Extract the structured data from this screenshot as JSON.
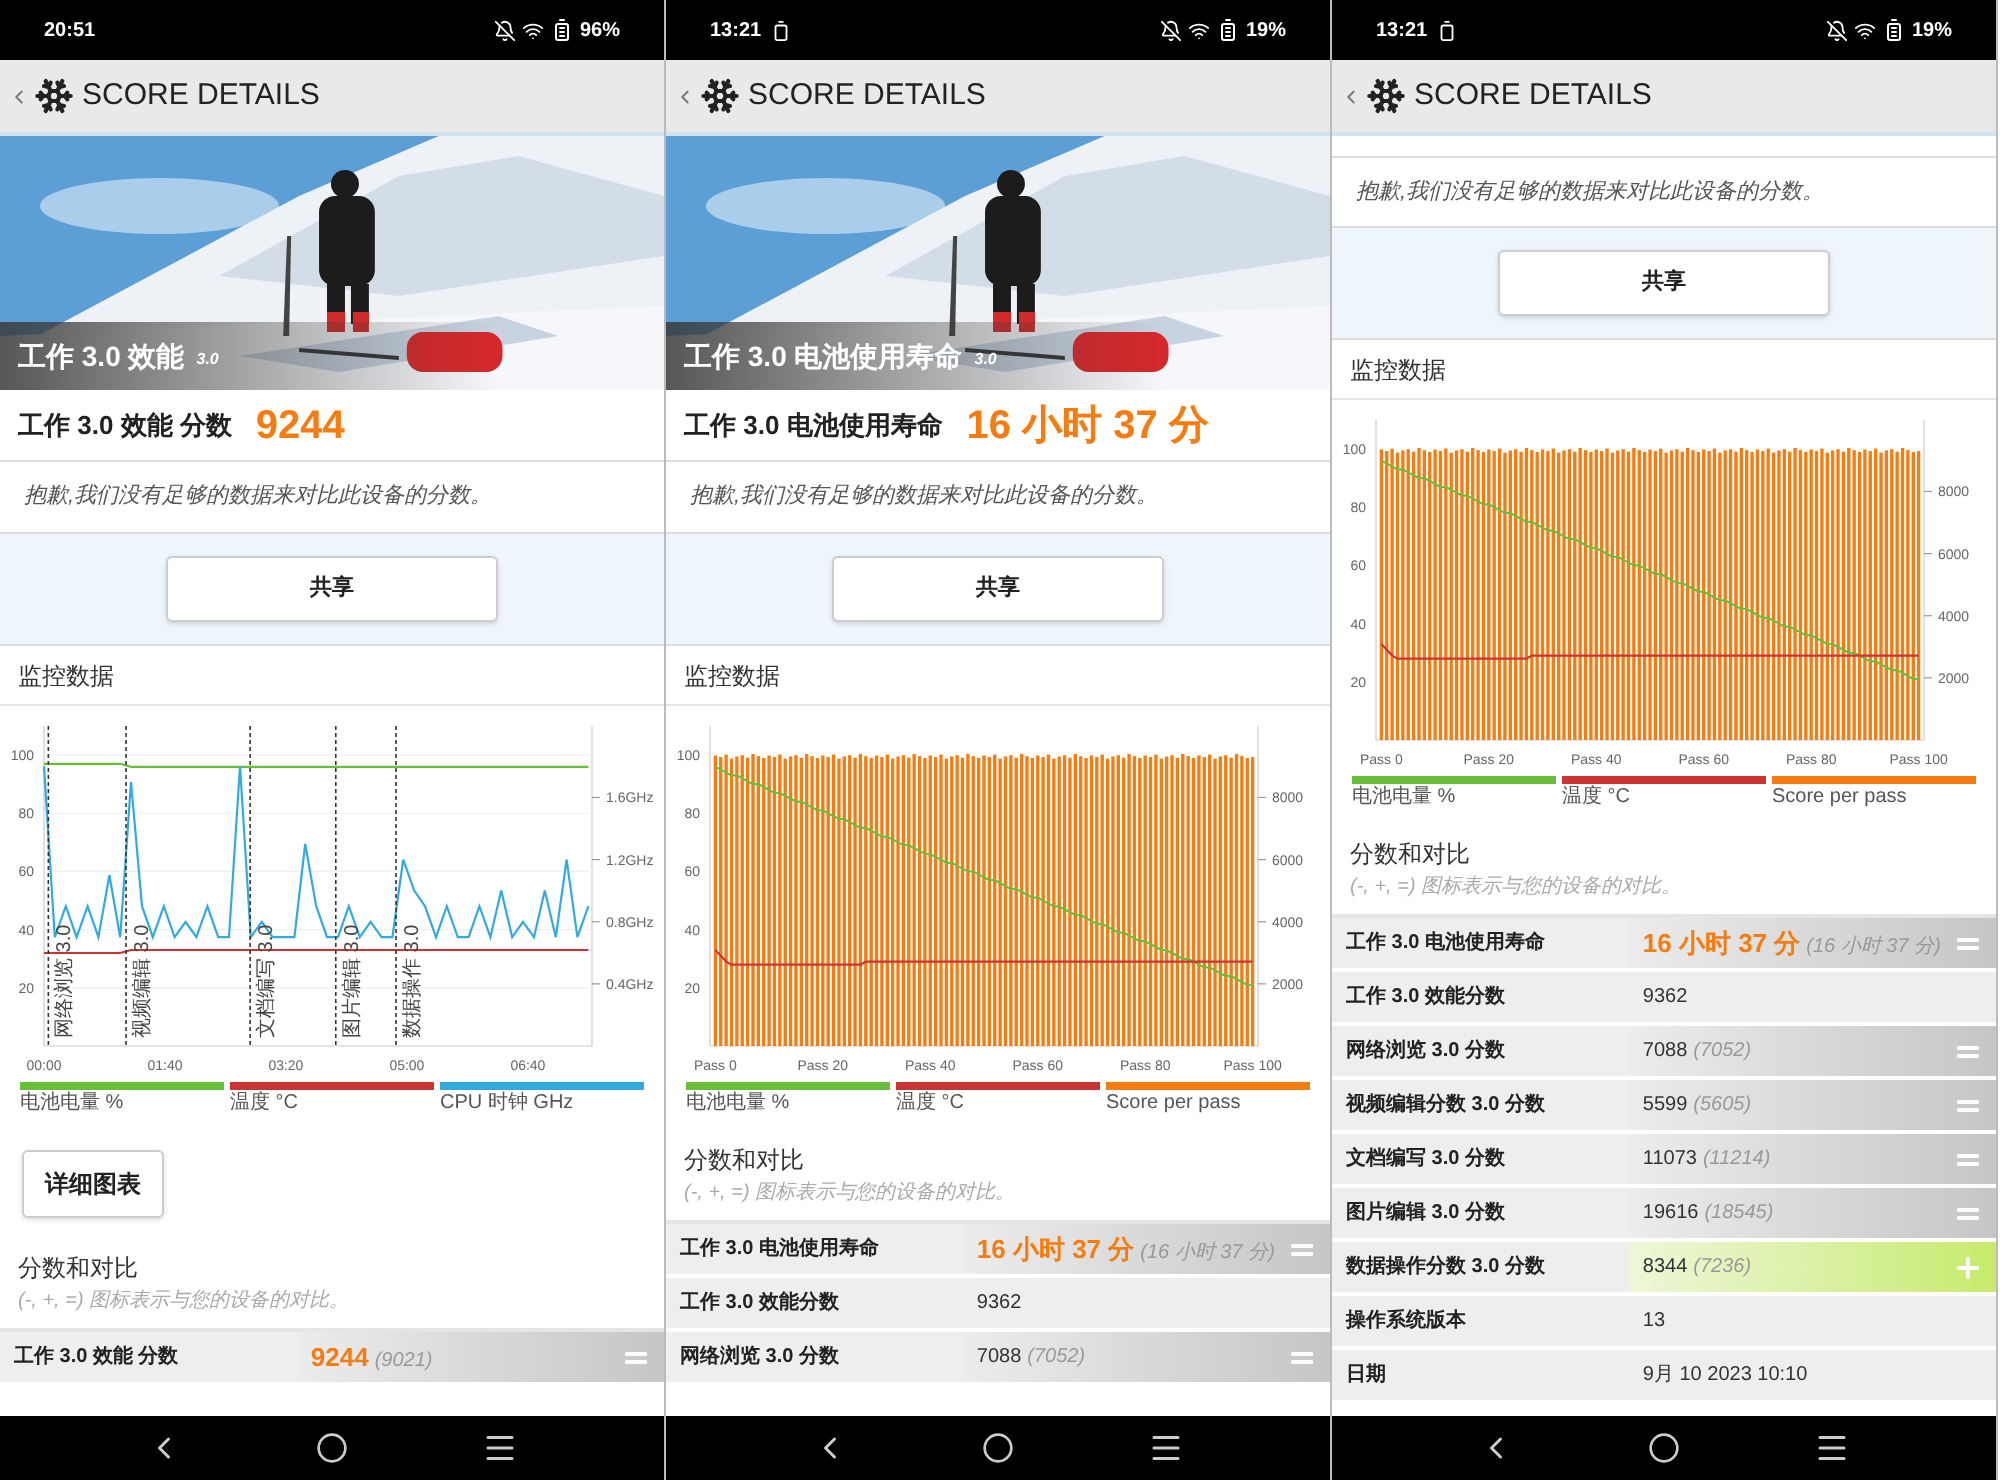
{
  "screens": [
    {
      "status": {
        "time": "20:51",
        "battery": "96%",
        "notification_icon": false
      },
      "header": {
        "title": "SCORE DETAILS"
      },
      "sections": [
        {
          "kind": "hero",
          "title": "工作 3.0 效能",
          "version": "3.0"
        },
        {
          "kind": "score",
          "label": "工作 3.0 效能 分数",
          "value": "9244"
        },
        {
          "kind": "notice",
          "text": "抱歉,我们没有足够的数据来对比此设备的分数。"
        },
        {
          "kind": "share",
          "label": "共享"
        },
        {
          "kind": "monitor",
          "heading": "监控数据",
          "chart_data": {
            "type": "line",
            "x": [
              0,
              0.15,
              0.3,
              0.45,
              0.6,
              0.75,
              0.9,
              1.05,
              1.2,
              1.35,
              1.5,
              1.65,
              1.8,
              1.95,
              2.1,
              2.25,
              2.4,
              2.55,
              2.7,
              2.85,
              3,
              3.15,
              3.3,
              3.45,
              3.6,
              3.75,
              3.9,
              4.05,
              4.2,
              4.35,
              4.5,
              4.65,
              4.8,
              4.95,
              5.1,
              5.25,
              5.4,
              5.55,
              5.7,
              5.85,
              6,
              6.15,
              6.3,
              6.45,
              6.6,
              6.75,
              6.9,
              7.05,
              7.2,
              7.35,
              7.5
            ],
            "xlim": [
              0,
              7.55
            ],
            "ylim": [
              0,
              110
            ],
            "y2lim": [
              0,
              2.06
            ],
            "xticks": [
              {
                "value": 0,
                "label": "00:00"
              },
              {
                "value": 1.667,
                "label": "01:40"
              },
              {
                "value": 3.333,
                "label": "03:20"
              },
              {
                "value": 5,
                "label": "05:00"
              },
              {
                "value": 6.667,
                "label": "06:40"
              }
            ],
            "yticks": [
              20,
              40,
              60,
              80,
              100
            ],
            "y2ticks": [
              {
                "value": 0.4,
                "label": "0.4GHz"
              },
              {
                "value": 0.8,
                "label": "0.8GHz"
              },
              {
                "value": 1.2,
                "label": "1.2GHz"
              },
              {
                "value": 1.6,
                "label": "1.6GHz"
              }
            ],
            "series": [
              {
                "name": "电池电量 %",
                "color": "#6abf3a",
                "values": [
                  97,
                  97,
                  97,
                  97,
                  97,
                  97,
                  97,
                  97,
                  96,
                  96,
                  96,
                  96,
                  96,
                  96,
                  96,
                  96,
                  96,
                  96,
                  96,
                  96,
                  96,
                  96,
                  96,
                  96,
                  96,
                  96,
                  96,
                  96,
                  96,
                  96,
                  96,
                  96,
                  96,
                  96,
                  96,
                  96,
                  96,
                  96,
                  96,
                  96,
                  96,
                  96,
                  96,
                  96,
                  96,
                  96,
                  96,
                  96,
                  96,
                  96,
                  96
                ]
              },
              {
                "name": "温度 °C",
                "color": "#cc3333",
                "values": [
                  32,
                  32,
                  32,
                  32,
                  32,
                  32,
                  32,
                  32,
                  33,
                  33,
                  33,
                  33,
                  33,
                  33,
                  33,
                  33,
                  33,
                  33,
                  33,
                  33,
                  33,
                  33,
                  33,
                  33,
                  33,
                  33,
                  33,
                  33,
                  33,
                  33,
                  33,
                  33,
                  33,
                  33,
                  33,
                  33,
                  33,
                  33,
                  33,
                  33,
                  33,
                  33,
                  33,
                  33,
                  33,
                  33,
                  33,
                  33,
                  33,
                  33,
                  33
                ]
              },
              {
                "name": "CPU 时钟 GHz",
                "color": "#33aadd",
                "axis": "y2",
                "values": [
                  1.8,
                  0.7,
                  0.9,
                  0.7,
                  0.9,
                  0.7,
                  1.1,
                  0.7,
                  1.7,
                  0.9,
                  0.7,
                  0.9,
                  0.7,
                  0.8,
                  0.7,
                  0.9,
                  0.7,
                  0.7,
                  1.8,
                  0.7,
                  0.8,
                  0.7,
                  0.7,
                  0.7,
                  1.3,
                  0.9,
                  0.7,
                  0.7,
                  0.9,
                  0.7,
                  0.8,
                  0.7,
                  0.7,
                  1.2,
                  1.0,
                  0.9,
                  0.7,
                  0.9,
                  0.7,
                  0.7,
                  0.9,
                  0.7,
                  1.0,
                  0.7,
                  0.8,
                  0.7,
                  1.0,
                  0.7,
                  1.2,
                  0.7,
                  0.9
                ]
              }
            ],
            "grid": true,
            "ref_lines": [
              {
                "axis": "x",
                "value": 0.06,
                "label": "网络浏览 3.0"
              },
              {
                "axis": "x",
                "value": 1.13,
                "label": "视频编辑 3.0"
              },
              {
                "axis": "x",
                "value": 2.84,
                "label": "文档编写 3.0"
              },
              {
                "axis": "x",
                "value": 4.02,
                "label": "图片编辑 3.0"
              },
              {
                "axis": "x",
                "value": 4.85,
                "label": "数据操作 3.0"
              }
            ]
          }
        },
        {
          "kind": "details",
          "label": "详细图表"
        },
        {
          "kind": "comparison",
          "heading": "分数和对比",
          "hint": "(-, +, =) 图标表示与您的设备的对比。",
          "rows": [
            {
              "label": "工作 3.0 效能 分数",
              "value": "9244",
              "reference": "(9021)",
              "kind": "equal",
              "primary": true
            }
          ]
        }
      ]
    },
    {
      "status": {
        "time": "13:21",
        "battery": "19%",
        "notification_icon": true
      },
      "header": {
        "title": "SCORE DETAILS"
      },
      "sections": [
        {
          "kind": "hero",
          "title": "工作 3.0 电池使用寿命",
          "version": "3.0"
        },
        {
          "kind": "score",
          "label": "工作 3.0 电池使用寿命",
          "value": "16 小时 37 分"
        },
        {
          "kind": "notice",
          "text": "抱歉,我们没有足够的数据来对比此设备的分数。"
        },
        {
          "kind": "share",
          "label": "共享"
        },
        {
          "kind": "monitor",
          "heading": "监控数据",
          "chart_data": {
            "type": "bar",
            "categories": [
              "Pass 0",
              null,
              null,
              null,
              null,
              null,
              null,
              null,
              null,
              null,
              null,
              null,
              null,
              null,
              null,
              null,
              null,
              null,
              null,
              null,
              "Pass 20",
              null,
              null,
              null,
              null,
              null,
              null,
              null,
              null,
              null,
              null,
              null,
              null,
              null,
              null,
              null,
              null,
              null,
              null,
              null,
              "Pass 40",
              null,
              null,
              null,
              null,
              null,
              null,
              null,
              null,
              null,
              null,
              null,
              null,
              null,
              null,
              null,
              null,
              null,
              null,
              null,
              "Pass 60",
              null,
              null,
              null,
              null,
              null,
              null,
              null,
              null,
              null,
              null,
              null,
              null,
              null,
              null,
              null,
              null,
              null,
              null,
              null,
              "Pass 80",
              null,
              null,
              null,
              null,
              null,
              null,
              null,
              null,
              null,
              null,
              null,
              null,
              null,
              null,
              null,
              null,
              null,
              null,
              null,
              "Pass 100"
            ],
            "ylim": [
              0,
              110
            ],
            "y2lim": [
              0,
              10300
            ],
            "yticks": [
              20,
              40,
              60,
              80,
              100
            ],
            "y2ticks": [
              2000,
              4000,
              6000,
              8000
            ],
            "series": [
              {
                "name": "电池电量 %",
                "color": "#6abf3a",
                "type": "line",
                "values": [
                  96,
                  95,
                  94,
                  93,
                  93,
                  92,
                  91,
                  90,
                  90,
                  89,
                  88,
                  87,
                  87,
                  86,
                  85,
                  84,
                  84,
                  83,
                  82,
                  81,
                  81,
                  80,
                  79,
                  78,
                  78,
                  77,
                  76,
                  75,
                  75,
                  74,
                  73,
                  72,
                  72,
                  71,
                  70,
                  69,
                  69,
                  68,
                  67,
                  66,
                  66,
                  65,
                  64,
                  63,
                  63,
                  62,
                  61,
                  60,
                  60,
                  59,
                  58,
                  57,
                  57,
                  56,
                  55,
                  54,
                  54,
                  53,
                  52,
                  51,
                  51,
                  50,
                  49,
                  48,
                  48,
                  47,
                  46,
                  45,
                  45,
                  44,
                  43,
                  42,
                  42,
                  41,
                  40,
                  39,
                  39,
                  38,
                  37,
                  36,
                  36,
                  35,
                  34,
                  33,
                  33,
                  32,
                  31,
                  30,
                  30,
                  29,
                  28,
                  27,
                  27,
                  26,
                  25,
                  24,
                  24,
                  23,
                  22,
                  21,
                  21
                ]
              },
              {
                "name": "温度 °C",
                "color": "#cc3333",
                "type": "line",
                "values": [
                  33,
                  31,
                  29,
                  28,
                  28,
                  28,
                  28,
                  28,
                  28,
                  28,
                  28,
                  28,
                  28,
                  28,
                  28,
                  28,
                  28,
                  28,
                  28,
                  28,
                  28,
                  28,
                  28,
                  28,
                  28,
                  28,
                  28,
                  28,
                  29,
                  29,
                  29,
                  29,
                  29,
                  29,
                  29,
                  29,
                  29,
                  29,
                  29,
                  29,
                  29,
                  29,
                  29,
                  29,
                  29,
                  29,
                  29,
                  29,
                  29,
                  29,
                  29,
                  29,
                  29,
                  29,
                  29,
                  29,
                  29,
                  29,
                  29,
                  29,
                  29,
                  29,
                  29,
                  29,
                  29,
                  29,
                  29,
                  29,
                  29,
                  29,
                  29,
                  29,
                  29,
                  29,
                  29,
                  29,
                  29,
                  29,
                  29,
                  29,
                  29,
                  29,
                  29,
                  29,
                  29,
                  29,
                  29,
                  29,
                  29,
                  29,
                  29,
                  29,
                  29,
                  29,
                  29,
                  29,
                  29,
                  29,
                  29,
                  29,
                  29
                ]
              },
              {
                "name": "Score per pass",
                "color": "#f57c10",
                "axis": "y2",
                "values": [
                  9350,
                  9300,
                  9380,
                  9250,
                  9320,
                  9360,
                  9280,
                  9400,
                  9330,
                  9270,
                  9350,
                  9300,
                  9380,
                  9250,
                  9320,
                  9360,
                  9280,
                  9400,
                  9330,
                  9270,
                  9350,
                  9300,
                  9380,
                  9250,
                  9320,
                  9360,
                  9280,
                  9400,
                  9330,
                  9270,
                  9350,
                  9300,
                  9380,
                  9250,
                  9320,
                  9360,
                  9280,
                  9400,
                  9330,
                  9270,
                  9350,
                  9300,
                  9380,
                  9250,
                  9320,
                  9360,
                  9280,
                  9400,
                  9330,
                  9270,
                  9350,
                  9300,
                  9380,
                  9250,
                  9320,
                  9360,
                  9280,
                  9400,
                  9330,
                  9270,
                  9350,
                  9300,
                  9380,
                  9250,
                  9320,
                  9360,
                  9280,
                  9400,
                  9330,
                  9270,
                  9350,
                  9300,
                  9380,
                  9250,
                  9320,
                  9360,
                  9280,
                  9400,
                  9330,
                  9270,
                  9350,
                  9300,
                  9380,
                  9250,
                  9320,
                  9360,
                  9280,
                  9400,
                  9330,
                  9270,
                  9350,
                  9300,
                  9380,
                  9250,
                  9320,
                  9360,
                  9280,
                  9400,
                  9330,
                  9270,
                  9300
                ]
              }
            ]
          }
        },
        {
          "kind": "comparison",
          "heading": "分数和对比",
          "hint": "(-, +, =) 图标表示与您的设备的对比。",
          "rows": [
            {
              "label": "工作 3.0 电池使用寿命",
              "value": "16 小时 37 分",
              "reference": "(16 小时 37 分)",
              "kind": "equal",
              "primary": true
            },
            {
              "label": "工作 3.0 效能分数",
              "value": "9362",
              "kind": "none",
              "primary": false
            },
            {
              "label": "网络浏览 3.0 分数",
              "value": "7088",
              "reference": "(7052)",
              "kind": "equal",
              "primary": false
            }
          ]
        }
      ]
    },
    {
      "status": {
        "time": "13:21",
        "battery": "19%",
        "notification_icon": true
      },
      "header": {
        "title": "SCORE DETAILS"
      },
      "sections": [
        {
          "kind": "notice",
          "text": "抱歉,我们没有足够的数据来对比此设备的分数。"
        },
        {
          "kind": "share",
          "label": "共享"
        },
        {
          "kind": "monitor",
          "heading": "监控数据",
          "chart_data": {
            "type": "bar",
            "categories": [
              "Pass 0",
              null,
              null,
              null,
              null,
              null,
              null,
              null,
              null,
              null,
              null,
              null,
              null,
              null,
              null,
              null,
              null,
              null,
              null,
              null,
              "Pass 20",
              null,
              null,
              null,
              null,
              null,
              null,
              null,
              null,
              null,
              null,
              null,
              null,
              null,
              null,
              null,
              null,
              null,
              null,
              null,
              "Pass 40",
              null,
              null,
              null,
              null,
              null,
              null,
              null,
              null,
              null,
              null,
              null,
              null,
              null,
              null,
              null,
              null,
              null,
              null,
              null,
              "Pass 60",
              null,
              null,
              null,
              null,
              null,
              null,
              null,
              null,
              null,
              null,
              null,
              null,
              null,
              null,
              null,
              null,
              null,
              null,
              null,
              "Pass 80",
              null,
              null,
              null,
              null,
              null,
              null,
              null,
              null,
              null,
              null,
              null,
              null,
              null,
              null,
              null,
              null,
              null,
              null,
              null,
              "Pass 100"
            ],
            "ylim": [
              0,
              110
            ],
            "y2lim": [
              0,
              10300
            ],
            "yticks": [
              20,
              40,
              60,
              80,
              100
            ],
            "y2ticks": [
              2000,
              4000,
              6000,
              8000
            ],
            "series": [
              {
                "name": "电池电量 %",
                "color": "#6abf3a",
                "type": "line",
                "values": [
                  96,
                  95,
                  94,
                  93,
                  93,
                  92,
                  91,
                  90,
                  90,
                  89,
                  88,
                  87,
                  87,
                  86,
                  85,
                  84,
                  84,
                  83,
                  82,
                  81,
                  81,
                  80,
                  79,
                  78,
                  78,
                  77,
                  76,
                  75,
                  75,
                  74,
                  73,
                  72,
                  72,
                  71,
                  70,
                  69,
                  69,
                  68,
                  67,
                  66,
                  66,
                  65,
                  64,
                  63,
                  63,
                  62,
                  61,
                  60,
                  60,
                  59,
                  58,
                  57,
                  57,
                  56,
                  55,
                  54,
                  54,
                  53,
                  52,
                  51,
                  51,
                  50,
                  49,
                  48,
                  48,
                  47,
                  46,
                  45,
                  45,
                  44,
                  43,
                  42,
                  42,
                  41,
                  40,
                  39,
                  39,
                  38,
                  37,
                  36,
                  36,
                  35,
                  34,
                  33,
                  33,
                  32,
                  31,
                  30,
                  30,
                  29,
                  28,
                  27,
                  27,
                  26,
                  25,
                  24,
                  24,
                  23,
                  22,
                  21,
                  21
                ]
              },
              {
                "name": "温度 °C",
                "color": "#cc3333",
                "type": "line",
                "values": [
                  33,
                  31,
                  29,
                  28,
                  28,
                  28,
                  28,
                  28,
                  28,
                  28,
                  28,
                  28,
                  28,
                  28,
                  28,
                  28,
                  28,
                  28,
                  28,
                  28,
                  28,
                  28,
                  28,
                  28,
                  28,
                  28,
                  28,
                  28,
                  29,
                  29,
                  29,
                  29,
                  29,
                  29,
                  29,
                  29,
                  29,
                  29,
                  29,
                  29,
                  29,
                  29,
                  29,
                  29,
                  29,
                  29,
                  29,
                  29,
                  29,
                  29,
                  29,
                  29,
                  29,
                  29,
                  29,
                  29,
                  29,
                  29,
                  29,
                  29,
                  29,
                  29,
                  29,
                  29,
                  29,
                  29,
                  29,
                  29,
                  29,
                  29,
                  29,
                  29,
                  29,
                  29,
                  29,
                  29,
                  29,
                  29,
                  29,
                  29,
                  29,
                  29,
                  29,
                  29,
                  29,
                  29,
                  29,
                  29,
                  29,
                  29,
                  29,
                  29,
                  29,
                  29,
                  29,
                  29,
                  29,
                  29,
                  29,
                  29,
                  29
                ]
              },
              {
                "name": "Score per pass",
                "color": "#f57c10",
                "axis": "y2",
                "values": [
                  9350,
                  9300,
                  9380,
                  9250,
                  9320,
                  9360,
                  9280,
                  9400,
                  9330,
                  9270,
                  9350,
                  9300,
                  9380,
                  9250,
                  9320,
                  9360,
                  9280,
                  9400,
                  9330,
                  9270,
                  9350,
                  9300,
                  9380,
                  9250,
                  9320,
                  9360,
                  9280,
                  9400,
                  9330,
                  9270,
                  9350,
                  9300,
                  9380,
                  9250,
                  9320,
                  9360,
                  9280,
                  9400,
                  9330,
                  9270,
                  9350,
                  9300,
                  9380,
                  9250,
                  9320,
                  9360,
                  9280,
                  9400,
                  9330,
                  9270,
                  9350,
                  9300,
                  9380,
                  9250,
                  9320,
                  9360,
                  9280,
                  9400,
                  9330,
                  9270,
                  9350,
                  9300,
                  9380,
                  9250,
                  9320,
                  9360,
                  9280,
                  9400,
                  9330,
                  9270,
                  9350,
                  9300,
                  9380,
                  9250,
                  9320,
                  9360,
                  9280,
                  9400,
                  9330,
                  9270,
                  9350,
                  9300,
                  9380,
                  9250,
                  9320,
                  9360,
                  9280,
                  9400,
                  9330,
                  9270,
                  9350,
                  9300,
                  9380,
                  9250,
                  9320,
                  9360,
                  9280,
                  9400,
                  9330,
                  9270,
                  9300
                ]
              }
            ]
          }
        },
        {
          "kind": "comparison",
          "heading": "分数和对比",
          "hint": "(-, +, =) 图标表示与您的设备的对比。",
          "rows": [
            {
              "label": "工作 3.0 电池使用寿命",
              "value": "16 小时 37 分",
              "reference": "(16 小时 37 分)",
              "kind": "equal",
              "primary": true
            },
            {
              "label": "工作 3.0 效能分数",
              "value": "9362",
              "kind": "none",
              "primary": false
            },
            {
              "label": "网络浏览 3.0 分数",
              "value": "7088",
              "reference": "(7052)",
              "kind": "equal",
              "primary": false
            },
            {
              "label": "视频编辑分数 3.0 分数",
              "value": "5599",
              "reference": "(5605)",
              "kind": "equal",
              "primary": false
            },
            {
              "label": "文档编写 3.0 分数",
              "value": "11073",
              "reference": "(11214)",
              "kind": "equal",
              "primary": false
            },
            {
              "label": "图片编辑 3.0 分数",
              "value": "19616",
              "reference": "(18545)",
              "kind": "equal",
              "primary": false
            },
            {
              "label": "数据操作分数 3.0 分数",
              "value": "8344",
              "reference": "(7236)",
              "kind": "plus",
              "primary": false
            },
            {
              "label": "操作系统版本",
              "value": "13",
              "kind": "none",
              "primary": false
            },
            {
              "label": "日期",
              "value": "9月 10 2023 10:10",
              "kind": "none",
              "primary": false
            }
          ]
        }
      ]
    }
  ]
}
